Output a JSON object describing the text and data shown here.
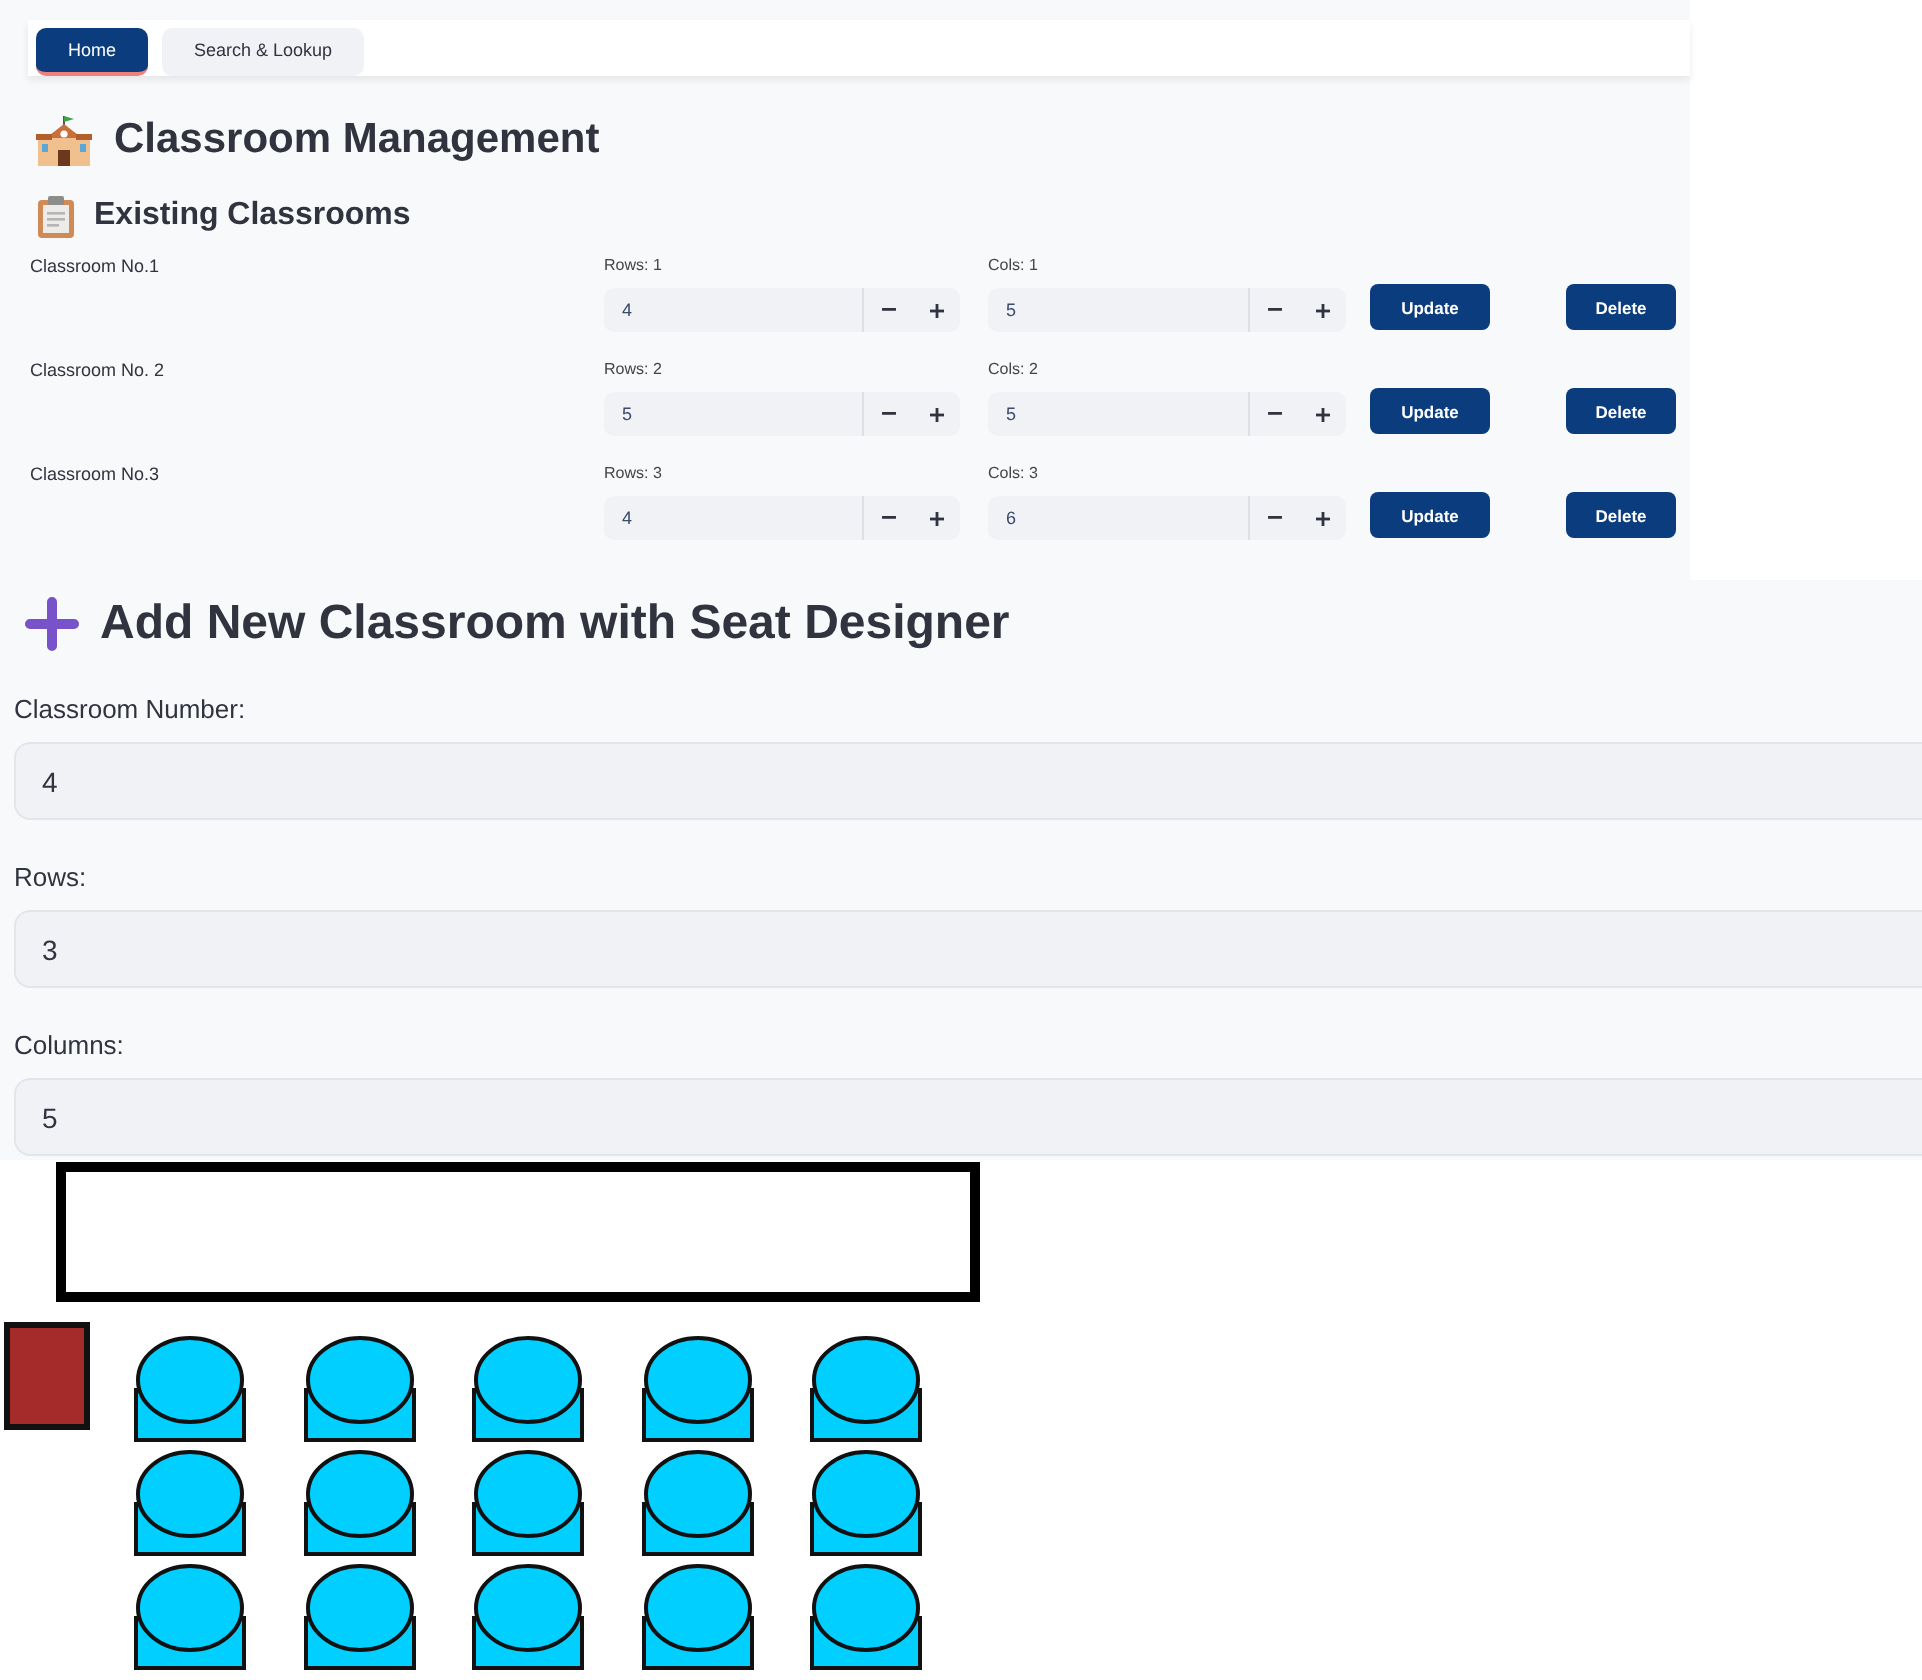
{
  "tabs": [
    {
      "label": "Home",
      "selected": true
    },
    {
      "label": "Search & Lookup",
      "selected": false
    }
  ],
  "title": "Classroom Management",
  "existing": {
    "heading": "Existing Classrooms",
    "classrooms": [
      {
        "name": "Classroom No.1",
        "rows_label": "Rows: 1",
        "rows": "4",
        "cols_label": "Cols: 1",
        "cols": "5",
        "update": "Update",
        "delete": "Delete"
      },
      {
        "name": "Classroom No. 2",
        "rows_label": "Rows: 2",
        "rows": "5",
        "cols_label": "Cols: 2",
        "cols": "5",
        "update": "Update",
        "delete": "Delete"
      },
      {
        "name": "Classroom No.3",
        "rows_label": "Rows: 3",
        "rows": "4",
        "cols_label": "Cols: 3",
        "cols": "6",
        "update": "Update",
        "delete": "Delete"
      }
    ]
  },
  "add_new": {
    "heading": "Add New Classroom with Seat Designer",
    "fields": [
      {
        "label": "Classroom Number:",
        "value": "4"
      },
      {
        "label": "Rows:",
        "value": "3"
      },
      {
        "label": "Columns:",
        "value": "5"
      }
    ]
  }
}
